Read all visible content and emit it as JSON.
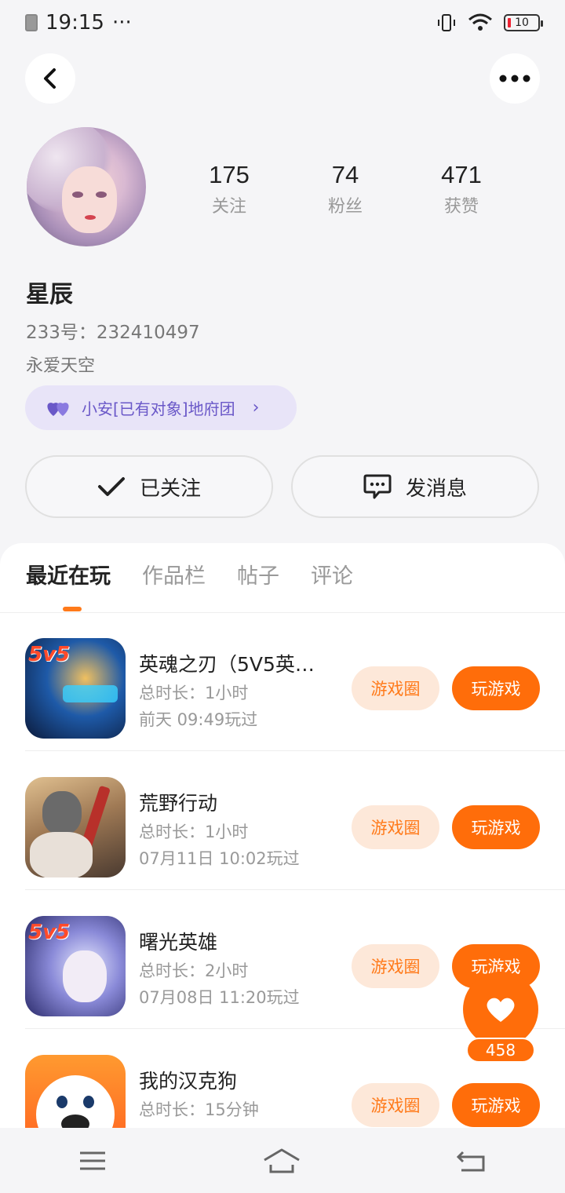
{
  "status_bar": {
    "time": "19:15",
    "dots": "···",
    "battery": "10"
  },
  "profile": {
    "stats": [
      {
        "value": "175",
        "label": "关注"
      },
      {
        "value": "74",
        "label": "粉丝"
      },
      {
        "value": "471",
        "label": "获赞"
      }
    ],
    "name": "星辰",
    "uid": "233号：232410497",
    "signature": "永爱天空",
    "group": "小安[已有对象]地府团",
    "follow_button": "已关注",
    "message_button": "发消息"
  },
  "tabs": [
    {
      "label": "最近在玩",
      "active": true
    },
    {
      "label": "作品栏",
      "active": false
    },
    {
      "label": "帖子",
      "active": false
    },
    {
      "label": "评论",
      "active": false
    }
  ],
  "games": [
    {
      "title": "英魂之刃（5V5英…",
      "duration": "总时长：1小时",
      "last_played": "前天 09:49玩过",
      "circle_label": "游戏圈",
      "play_label": "玩游戏",
      "icon_badge": "5v5",
      "colors": [
        "#0b1a3a",
        "#1e5aa8",
        "#f0c060"
      ]
    },
    {
      "title": "荒野行动",
      "duration": "总时长：1小时",
      "last_played": "07月11日 10:02玩过",
      "circle_label": "游戏圈",
      "play_label": "玩游戏",
      "icon_badge": "",
      "colors": [
        "#c8a070",
        "#7a5a40",
        "#b8302a"
      ]
    },
    {
      "title": "曙光英雄",
      "duration": "总时长：2小时",
      "last_played": "07月08日 11:20玩过",
      "circle_label": "游戏圈",
      "play_label": "玩游戏",
      "icon_badge": "5v5",
      "colors": [
        "#2a2a6a",
        "#8a8ad8",
        "#e8eaff"
      ]
    },
    {
      "title": "我的汉克狗",
      "duration": "总时长：15分钟",
      "last_played": "",
      "circle_label": "游戏圈",
      "play_label": "玩游戏",
      "icon_badge": "",
      "colors": [
        "#ff6020",
        "#ff9a30",
        "#ffffff"
      ]
    }
  ],
  "like_count": "458",
  "accent": "#ff6d0a"
}
